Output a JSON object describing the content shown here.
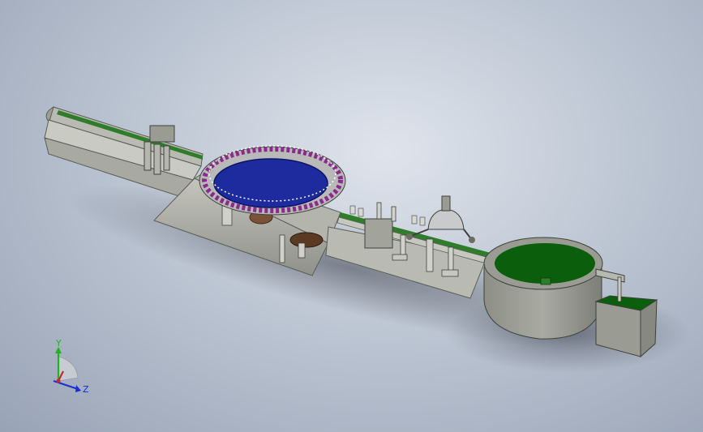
{
  "viewport": {
    "background": "#bdc6d3",
    "model_colors": {
      "frame": "#9a9c94",
      "belt": "#2f7d2a",
      "turntable": "#1d2b9e",
      "star_wheel_pockets": "#8a2a8c",
      "hopper_interior": "#0b5e0b"
    }
  },
  "triad": {
    "y_label": "Y",
    "z_label": "Z",
    "y_color": "#1fb31f",
    "z_color": "#1a2fd0",
    "x_color": "#c42a2a"
  }
}
